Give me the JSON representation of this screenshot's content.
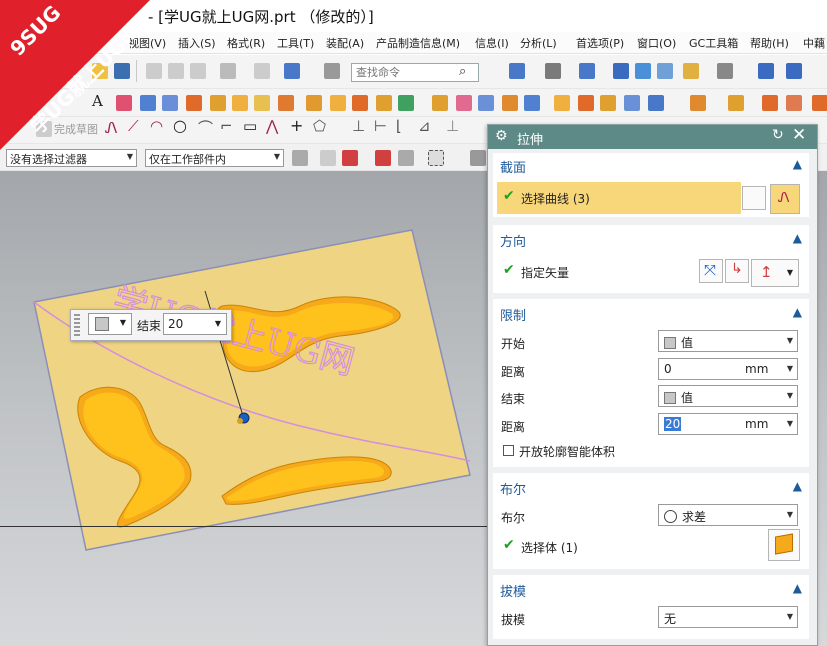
{
  "window": {
    "title": "- [学UG就上UG网.prt （修改的）]"
  },
  "watermark": {
    "brand": "9SUG",
    "text": "学UG就上UG网"
  },
  "menubar": {
    "items": [
      "视图(V)",
      "插入(S)",
      "格式(R)",
      "工具(T)",
      "装配(A)",
      "产品制造信息(M)",
      "信息(I)",
      "分析(L)",
      "首选项(P)",
      "窗口(O)",
      "GC工具箱",
      "帮助(H)",
      "中藕"
    ]
  },
  "toolbar": {
    "command_search_placeholder": "查找命令",
    "done_sketch_label": "完成草图",
    "selection_filter": "没有选择过滤器",
    "scope_filter": "仅在工作部件内"
  },
  "graphics": {
    "part_label": "学UG就上UG网",
    "floating_input": {
      "label": "结束",
      "value": "20"
    }
  },
  "dialog": {
    "title": "拉伸",
    "section_label": {
      "header": "截面",
      "select_curve": "选择曲线 (3)"
    },
    "direction": {
      "header": "方向",
      "specify_vector": "指定矢量"
    },
    "limits": {
      "header": "限制",
      "start_label": "开始",
      "start_option": "值",
      "start_distance_label": "距离",
      "start_distance": "0",
      "start_unit": "mm",
      "end_label": "结束",
      "end_option": "值",
      "end_distance_label": "距离",
      "end_distance": "20",
      "end_unit": "mm",
      "open_profile": "开放轮廓智能体积"
    },
    "boolean": {
      "header": "布尔",
      "label": "布尔",
      "option": "求差",
      "select_body": "选择体 (1)"
    },
    "draft": {
      "header": "拔模",
      "label": "拔模",
      "option": "无"
    }
  },
  "colors": {
    "dialog_header": "#5d8a87",
    "section_header_text": "#1f5b9a",
    "selected_row": "#f7d77a",
    "part_face": "#eed483",
    "pocket_fill": "#ffc21c",
    "part_text": "#d58ee0",
    "check_green": "#1fa21f"
  }
}
